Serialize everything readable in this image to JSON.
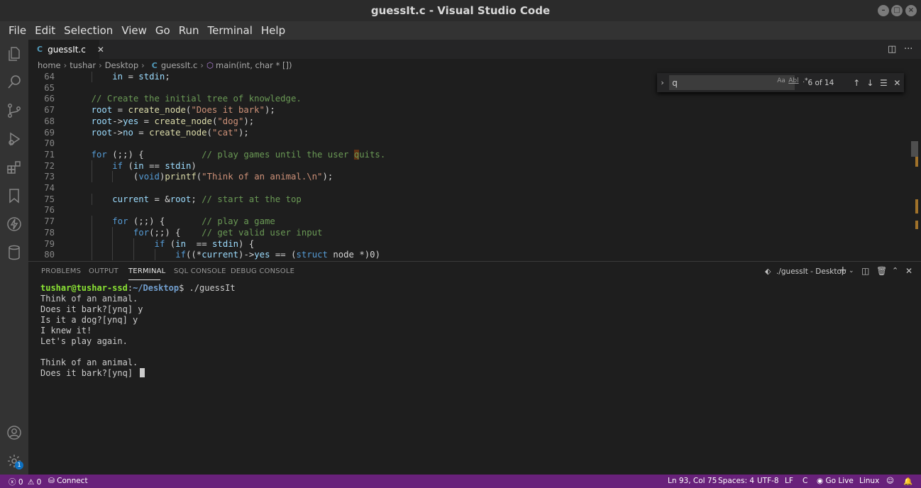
{
  "window": {
    "title": "guessIt.c - Visual Studio Code"
  },
  "menu": [
    "File",
    "Edit",
    "Selection",
    "View",
    "Go",
    "Run",
    "Terminal",
    "Help"
  ],
  "tab": {
    "icon_letter": "C",
    "label": "guessIt.c"
  },
  "breadcrumb": [
    "home",
    "tushar",
    "Desktop",
    "guessIt.c",
    "main(int, char * [])"
  ],
  "breadcrumb_file_icon": "C",
  "editor": {
    "lines": [
      {
        "n": "64",
        "indent": 8,
        "code": "in = stdin;"
      },
      {
        "n": "65",
        "indent": 0,
        "code": ""
      },
      {
        "n": "66",
        "indent": 4,
        "code": "// Create the initial tree of knowledge."
      },
      {
        "n": "67",
        "indent": 4,
        "code": "root = create_node(\"Does it bark\");"
      },
      {
        "n": "68",
        "indent": 4,
        "code": "root->yes = create_node(\"dog\");"
      },
      {
        "n": "69",
        "indent": 4,
        "code": "root->no = create_node(\"cat\");"
      },
      {
        "n": "70",
        "indent": 0,
        "code": ""
      },
      {
        "n": "71",
        "indent": 4,
        "code": "for (;;) {           // play games until the user quits."
      },
      {
        "n": "72",
        "indent": 8,
        "code": "if (in == stdin)"
      },
      {
        "n": "73",
        "indent": 12,
        "code": "(void)printf(\"Think of an animal.\\n\");"
      },
      {
        "n": "74",
        "indent": 0,
        "code": ""
      },
      {
        "n": "75",
        "indent": 8,
        "code": "current = &root; // start at the top"
      },
      {
        "n": "76",
        "indent": 0,
        "code": ""
      },
      {
        "n": "77",
        "indent": 8,
        "code": "for (;;) {       // play a game"
      },
      {
        "n": "78",
        "indent": 12,
        "code": "for(;;) {    // get valid user input"
      },
      {
        "n": "79",
        "indent": 16,
        "code": "if (in  == stdin) {"
      },
      {
        "n": "80",
        "indent": 20,
        "code": "if((*current)->yes == (struct node *)0)"
      }
    ]
  },
  "find": {
    "query": "q",
    "match_case_label": "Aa",
    "whole_word_label": "Abl",
    "regex_label": ".*",
    "count": "6 of 14"
  },
  "panel": {
    "tabs": [
      "PROBLEMS",
      "OUTPUT",
      "TERMINAL",
      "SQL CONSOLE",
      "DEBUG CONSOLE"
    ],
    "active_tab": "TERMINAL",
    "terminal_name": "./guessIt - Desktop"
  },
  "terminal": {
    "prompt_user": "tushar@tushar-ssd",
    "prompt_path": "~/Desktop",
    "prompt_suffix": "$ ./guessIt",
    "output": [
      "Think of an animal.",
      "Does it bark?[ynq] y",
      "Is it a dog?[ynq] y",
      "I knew it!",
      "Let's play again.",
      "",
      "Think of an animal.",
      "Does it bark?[ynq] "
    ]
  },
  "statusbar": {
    "errors": "0",
    "warnings": "0",
    "connect": "Connect",
    "position": "Ln 93, Col 75",
    "spaces": "Spaces: 4",
    "encoding": "UTF-8",
    "eol": "LF",
    "language": "C",
    "golive": "Go Live",
    "os": "Linux",
    "color": "#68217a"
  },
  "accounts_badge": "1"
}
